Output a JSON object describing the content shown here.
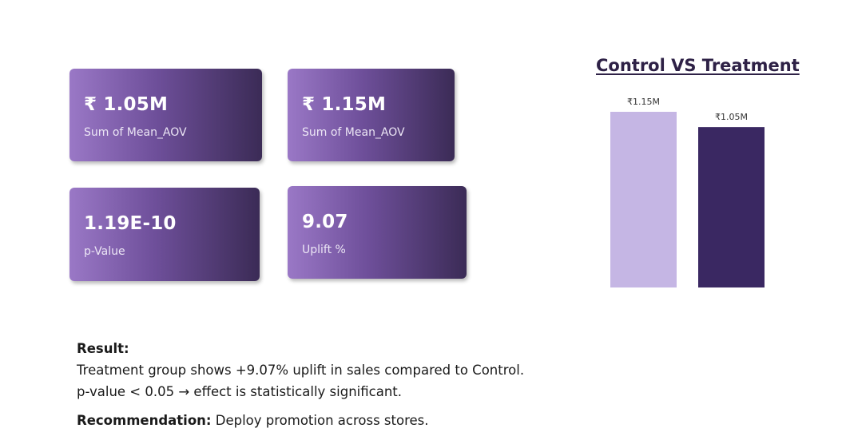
{
  "kpis": [
    {
      "value": "₹ 1.05M",
      "label": "Sum of Mean_AOV"
    },
    {
      "value": "₹ 1.15M",
      "label": "Sum of Mean_AOV"
    },
    {
      "value": "1.19E-10",
      "label": "p-Value"
    },
    {
      "value": "9.07",
      "label": "Uplift %"
    }
  ],
  "chart_data": {
    "type": "bar",
    "title": "Control VS Treatment",
    "values": [
      1.15,
      1.05
    ],
    "data_labels": [
      "₹1.15M",
      "₹1.05M"
    ],
    "colors": [
      "#c5b6e4",
      "#3a2862"
    ],
    "ylim": [
      0,
      1.15
    ]
  },
  "result": {
    "heading": "Result:",
    "line1": "Treatment group shows +9.07% uplift in sales compared to Control.",
    "line2": "p-value < 0.05 → effect is statistically significant."
  },
  "recommendation": {
    "heading": "Recommendation:",
    "text": " Deploy promotion across stores."
  }
}
